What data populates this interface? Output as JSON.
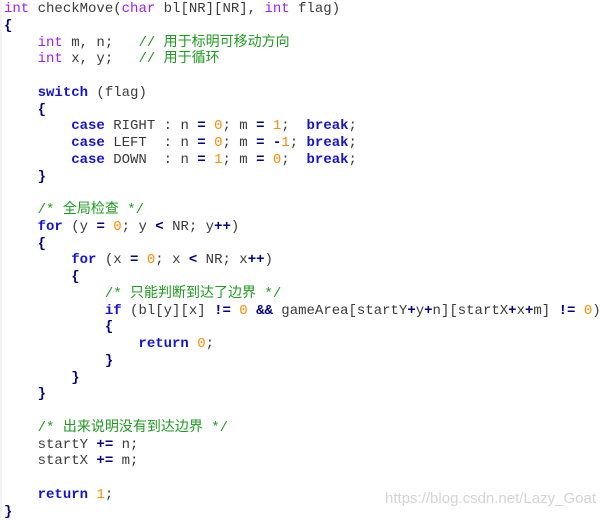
{
  "colors": {
    "type_keyword": "#a020f0",
    "control_keyword": "#1414d0",
    "number": "#ff8c00",
    "comment": "#1f9a1f",
    "operator": "#000080"
  },
  "code_lines": [
    [
      [
        "kw",
        "int"
      ],
      [
        "txt",
        " checkMove("
      ],
      [
        "kw",
        "char"
      ],
      [
        "txt",
        " bl[NR][NR], "
      ],
      [
        "kw",
        "int"
      ],
      [
        "txt",
        " flag)"
      ]
    ],
    [
      [
        "op",
        "{"
      ]
    ],
    [
      [
        "txt",
        "    "
      ],
      [
        "kw",
        "int"
      ],
      [
        "txt",
        " m, n;   "
      ],
      [
        "cm",
        "// 用于标明可移动方向"
      ]
    ],
    [
      [
        "txt",
        "    "
      ],
      [
        "kw",
        "int"
      ],
      [
        "txt",
        " x, y;   "
      ],
      [
        "cm",
        "// 用于循环"
      ]
    ],
    [],
    [
      [
        "txt",
        "    "
      ],
      [
        "ctl",
        "switch"
      ],
      [
        "txt",
        " (flag)"
      ]
    ],
    [
      [
        "txt",
        "    "
      ],
      [
        "op",
        "{"
      ]
    ],
    [
      [
        "txt",
        "        "
      ],
      [
        "ctl",
        "case"
      ],
      [
        "txt",
        " RIGHT : n "
      ],
      [
        "op",
        "="
      ],
      [
        "txt",
        " "
      ],
      [
        "num",
        "0"
      ],
      [
        "txt",
        "; m "
      ],
      [
        "op",
        "="
      ],
      [
        "txt",
        " "
      ],
      [
        "num",
        "1"
      ],
      [
        "txt",
        ";  "
      ],
      [
        "ctl",
        "break"
      ],
      [
        "txt",
        ";"
      ]
    ],
    [
      [
        "txt",
        "        "
      ],
      [
        "ctl",
        "case"
      ],
      [
        "txt",
        " LEFT  : n "
      ],
      [
        "op",
        "="
      ],
      [
        "txt",
        " "
      ],
      [
        "num",
        "0"
      ],
      [
        "txt",
        "; m "
      ],
      [
        "op",
        "="
      ],
      [
        "txt",
        " "
      ],
      [
        "op",
        "-"
      ],
      [
        "num",
        "1"
      ],
      [
        "txt",
        "; "
      ],
      [
        "ctl",
        "break"
      ],
      [
        "txt",
        ";"
      ]
    ],
    [
      [
        "txt",
        "        "
      ],
      [
        "ctl",
        "case"
      ],
      [
        "txt",
        " DOWN  : n "
      ],
      [
        "op",
        "="
      ],
      [
        "txt",
        " "
      ],
      [
        "num",
        "1"
      ],
      [
        "txt",
        "; m "
      ],
      [
        "op",
        "="
      ],
      [
        "txt",
        " "
      ],
      [
        "num",
        "0"
      ],
      [
        "txt",
        ";  "
      ],
      [
        "ctl",
        "break"
      ],
      [
        "txt",
        ";"
      ]
    ],
    [
      [
        "txt",
        "    "
      ],
      [
        "op",
        "}"
      ]
    ],
    [],
    [
      [
        "txt",
        "    "
      ],
      [
        "cm",
        "/* 全局检查 */"
      ]
    ],
    [
      [
        "txt",
        "    "
      ],
      [
        "ctl",
        "for"
      ],
      [
        "txt",
        " (y "
      ],
      [
        "op",
        "="
      ],
      [
        "txt",
        " "
      ],
      [
        "num",
        "0"
      ],
      [
        "txt",
        "; y "
      ],
      [
        "op",
        "<"
      ],
      [
        "txt",
        " NR; y"
      ],
      [
        "op",
        "++"
      ],
      [
        "txt",
        ")"
      ]
    ],
    [
      [
        "txt",
        "    "
      ],
      [
        "op",
        "{"
      ]
    ],
    [
      [
        "txt",
        "        "
      ],
      [
        "ctl",
        "for"
      ],
      [
        "txt",
        " (x "
      ],
      [
        "op",
        "="
      ],
      [
        "txt",
        " "
      ],
      [
        "num",
        "0"
      ],
      [
        "txt",
        "; x "
      ],
      [
        "op",
        "<"
      ],
      [
        "txt",
        " NR; x"
      ],
      [
        "op",
        "++"
      ],
      [
        "txt",
        ")"
      ]
    ],
    [
      [
        "txt",
        "        "
      ],
      [
        "op",
        "{"
      ]
    ],
    [
      [
        "txt",
        "            "
      ],
      [
        "cm",
        "/* 只能判断到达了边界 */"
      ]
    ],
    [
      [
        "txt",
        "            "
      ],
      [
        "ctl",
        "if"
      ],
      [
        "txt",
        " (bl[y][x] "
      ],
      [
        "op",
        "!="
      ],
      [
        "txt",
        " "
      ],
      [
        "num",
        "0"
      ],
      [
        "txt",
        " "
      ],
      [
        "op",
        "&&"
      ],
      [
        "txt",
        " gameArea[startY"
      ],
      [
        "op",
        "+"
      ],
      [
        "txt",
        "y"
      ],
      [
        "op",
        "+"
      ],
      [
        "txt",
        "n][startX"
      ],
      [
        "op",
        "+"
      ],
      [
        "txt",
        "x"
      ],
      [
        "op",
        "+"
      ],
      [
        "txt",
        "m] "
      ],
      [
        "op",
        "!="
      ],
      [
        "txt",
        " "
      ],
      [
        "num",
        "0"
      ],
      [
        "txt",
        ")"
      ]
    ],
    [
      [
        "txt",
        "            "
      ],
      [
        "op",
        "{"
      ]
    ],
    [
      [
        "txt",
        "                "
      ],
      [
        "ctl",
        "return"
      ],
      [
        "txt",
        " "
      ],
      [
        "num",
        "0"
      ],
      [
        "txt",
        ";"
      ]
    ],
    [
      [
        "txt",
        "            "
      ],
      [
        "op",
        "}"
      ]
    ],
    [
      [
        "txt",
        "        "
      ],
      [
        "op",
        "}"
      ]
    ],
    [
      [
        "txt",
        "    "
      ],
      [
        "op",
        "}"
      ]
    ],
    [],
    [
      [
        "txt",
        "    "
      ],
      [
        "cm",
        "/* 出来说明没有到达边界 */"
      ]
    ],
    [
      [
        "txt",
        "    startY "
      ],
      [
        "op",
        "+="
      ],
      [
        "txt",
        " n;"
      ]
    ],
    [
      [
        "txt",
        "    startX "
      ],
      [
        "op",
        "+="
      ],
      [
        "txt",
        " m;"
      ]
    ],
    [],
    [
      [
        "txt",
        "    "
      ],
      [
        "ctl",
        "return"
      ],
      [
        "txt",
        " "
      ],
      [
        "num",
        "1"
      ],
      [
        "txt",
        ";"
      ]
    ],
    [
      [
        "op",
        "}"
      ]
    ]
  ],
  "watermark": "https://blog.csdn.net/Lazy_Goat"
}
